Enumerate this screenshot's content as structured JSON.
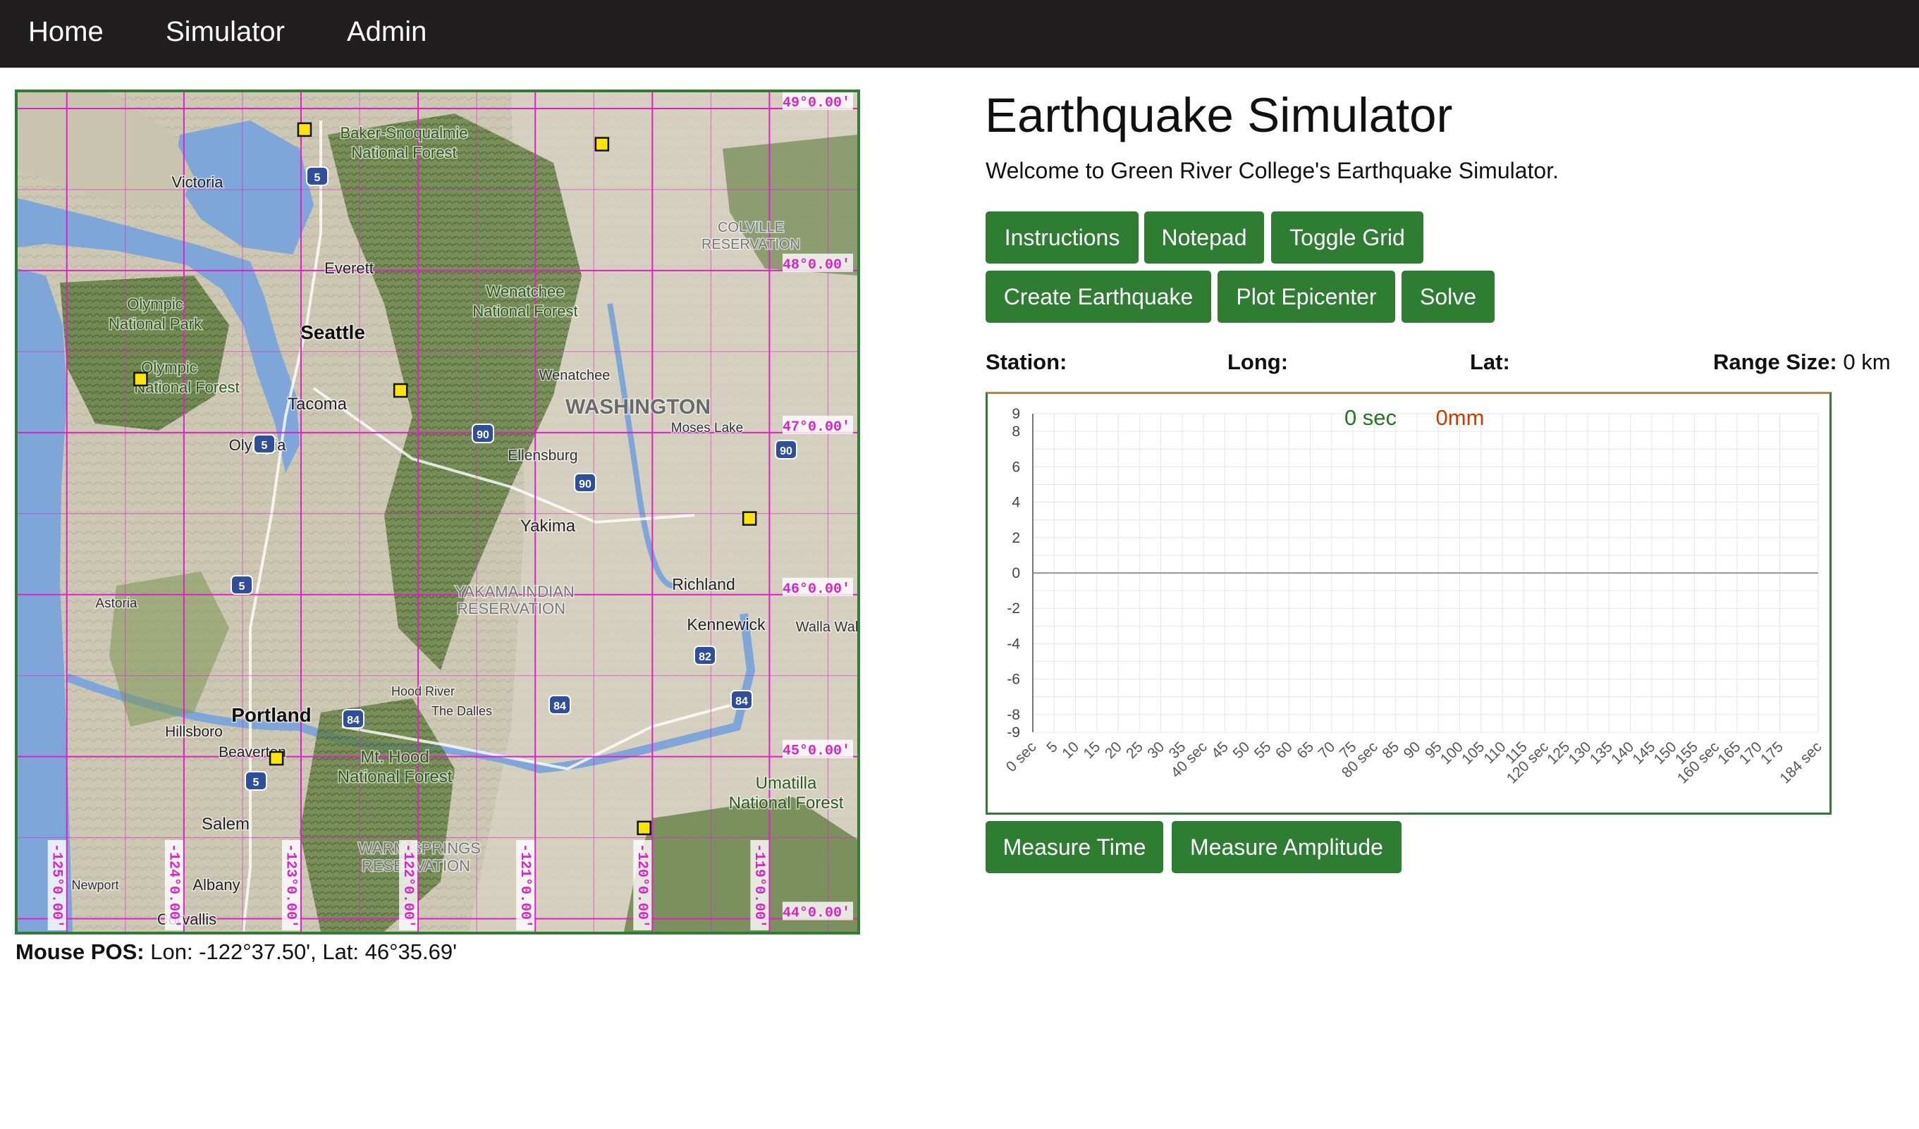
{
  "nav": {
    "items": [
      "Home",
      "Simulator",
      "Admin"
    ]
  },
  "page": {
    "title": "Earthquake Simulator",
    "welcome": "Welcome to Green River College's Earthquake Simulator."
  },
  "buttons": {
    "instructions": "Instructions",
    "notepad": "Notepad",
    "toggle_grid": "Toggle Grid",
    "create_earthquake": "Create Earthquake",
    "plot_epicenter": "Plot Epicenter",
    "solve": "Solve",
    "measure_time": "Measure Time",
    "measure_amplitude": "Measure Amplitude"
  },
  "station_info": {
    "station_label": "Station:",
    "long_label": "Long:",
    "lat_label": "Lat:",
    "range_label": "Range Size:",
    "range_value": "0 km"
  },
  "mouse_pos": {
    "label": "Mouse POS:",
    "value": "Lon: -122°37.50', Lat: 46°35.69'"
  },
  "map": {
    "lat_labels": [
      "49°0.00'",
      "48°0.00'",
      "47°0.00'",
      "46°0.00'",
      "45°0.00'",
      "44°0.00'"
    ],
    "lon_labels": [
      "-125°0.00'",
      "-124°0.00'",
      "-123°0.00'",
      "-122°0.00'",
      "-121°0.00'",
      "-120°0.00'",
      "-119°0.00'"
    ],
    "place_labels": [
      "Victoria",
      "Everett",
      "Seattle",
      "Tacoma",
      "Olympia",
      "Baker-Snoqualmie",
      "National Forest",
      "Olympic",
      "National Park",
      "Olympic",
      "National Forest",
      "Wenatchee",
      "National Forest",
      "Wenatchee",
      "WASHINGTON",
      "Moses Lake",
      "Ellensburg",
      "Yakima",
      "Richland",
      "Kennewick",
      "Walla Wal",
      "Astoria",
      "YAKAMA INDIAN",
      "RESERVATION",
      "Hood River",
      "The Dalles",
      "Portland",
      "Hillsboro",
      "Beaverton",
      "Mt. Hood",
      "National Forest",
      "Umatilla",
      "National Forest",
      "Salem",
      "Albany",
      "Newport",
      "Corvallis",
      "WARM SPRINGS",
      "RESERVATION",
      "COLVILLE",
      "RESERVATION"
    ],
    "highway_labels": [
      "5",
      "5",
      "90",
      "90",
      "90",
      "5",
      "82",
      "84",
      "84",
      "84",
      "5"
    ],
    "stations": [
      {
        "lon": -122.97,
        "lat": 48.87
      },
      {
        "lon": -120.43,
        "lat": 48.78
      },
      {
        "lon": -124.37,
        "lat": 47.33
      },
      {
        "lon": -122.15,
        "lat": 47.26
      },
      {
        "lon": -119.17,
        "lat": 46.47
      },
      {
        "lon": -123.21,
        "lat": 44.99
      },
      {
        "lon": -120.07,
        "lat": 44.56
      }
    ],
    "colors": {
      "grid": "#e020c8",
      "station": "#ffe500",
      "water": "#7fa6d8",
      "land": "#cfcab8",
      "forest": "#5e7b3c"
    }
  },
  "seismograph": {
    "live_time": "0 sec",
    "live_amplitude": "0mm",
    "colors": {
      "time": "#1e7a1e",
      "amplitude": "#d03a00",
      "axis": "#777777",
      "grid": "#e6e6e6"
    }
  },
  "chart_data": {
    "type": "line",
    "title": "",
    "xlabel": "",
    "ylabel": "",
    "xlim": [
      0,
      184
    ],
    "ylim": [
      -9,
      9
    ],
    "y_ticks": [
      "9",
      "8",
      "6",
      "4",
      "2",
      "0",
      "-2",
      "-4",
      "-6",
      "-8",
      "-9"
    ],
    "x_ticks": [
      "0 sec",
      "5",
      "10",
      "15",
      "20",
      "25",
      "30",
      "35",
      "40 sec",
      "45",
      "50",
      "55",
      "60",
      "65",
      "70",
      "75",
      "80 sec",
      "85",
      "90",
      "95",
      "100",
      "105",
      "110",
      "115",
      "120 sec",
      "125",
      "130",
      "135",
      "140",
      "145",
      "150",
      "155",
      "160 sec",
      "165",
      "170",
      "175",
      "184 sec"
    ],
    "grid": true,
    "series": []
  }
}
